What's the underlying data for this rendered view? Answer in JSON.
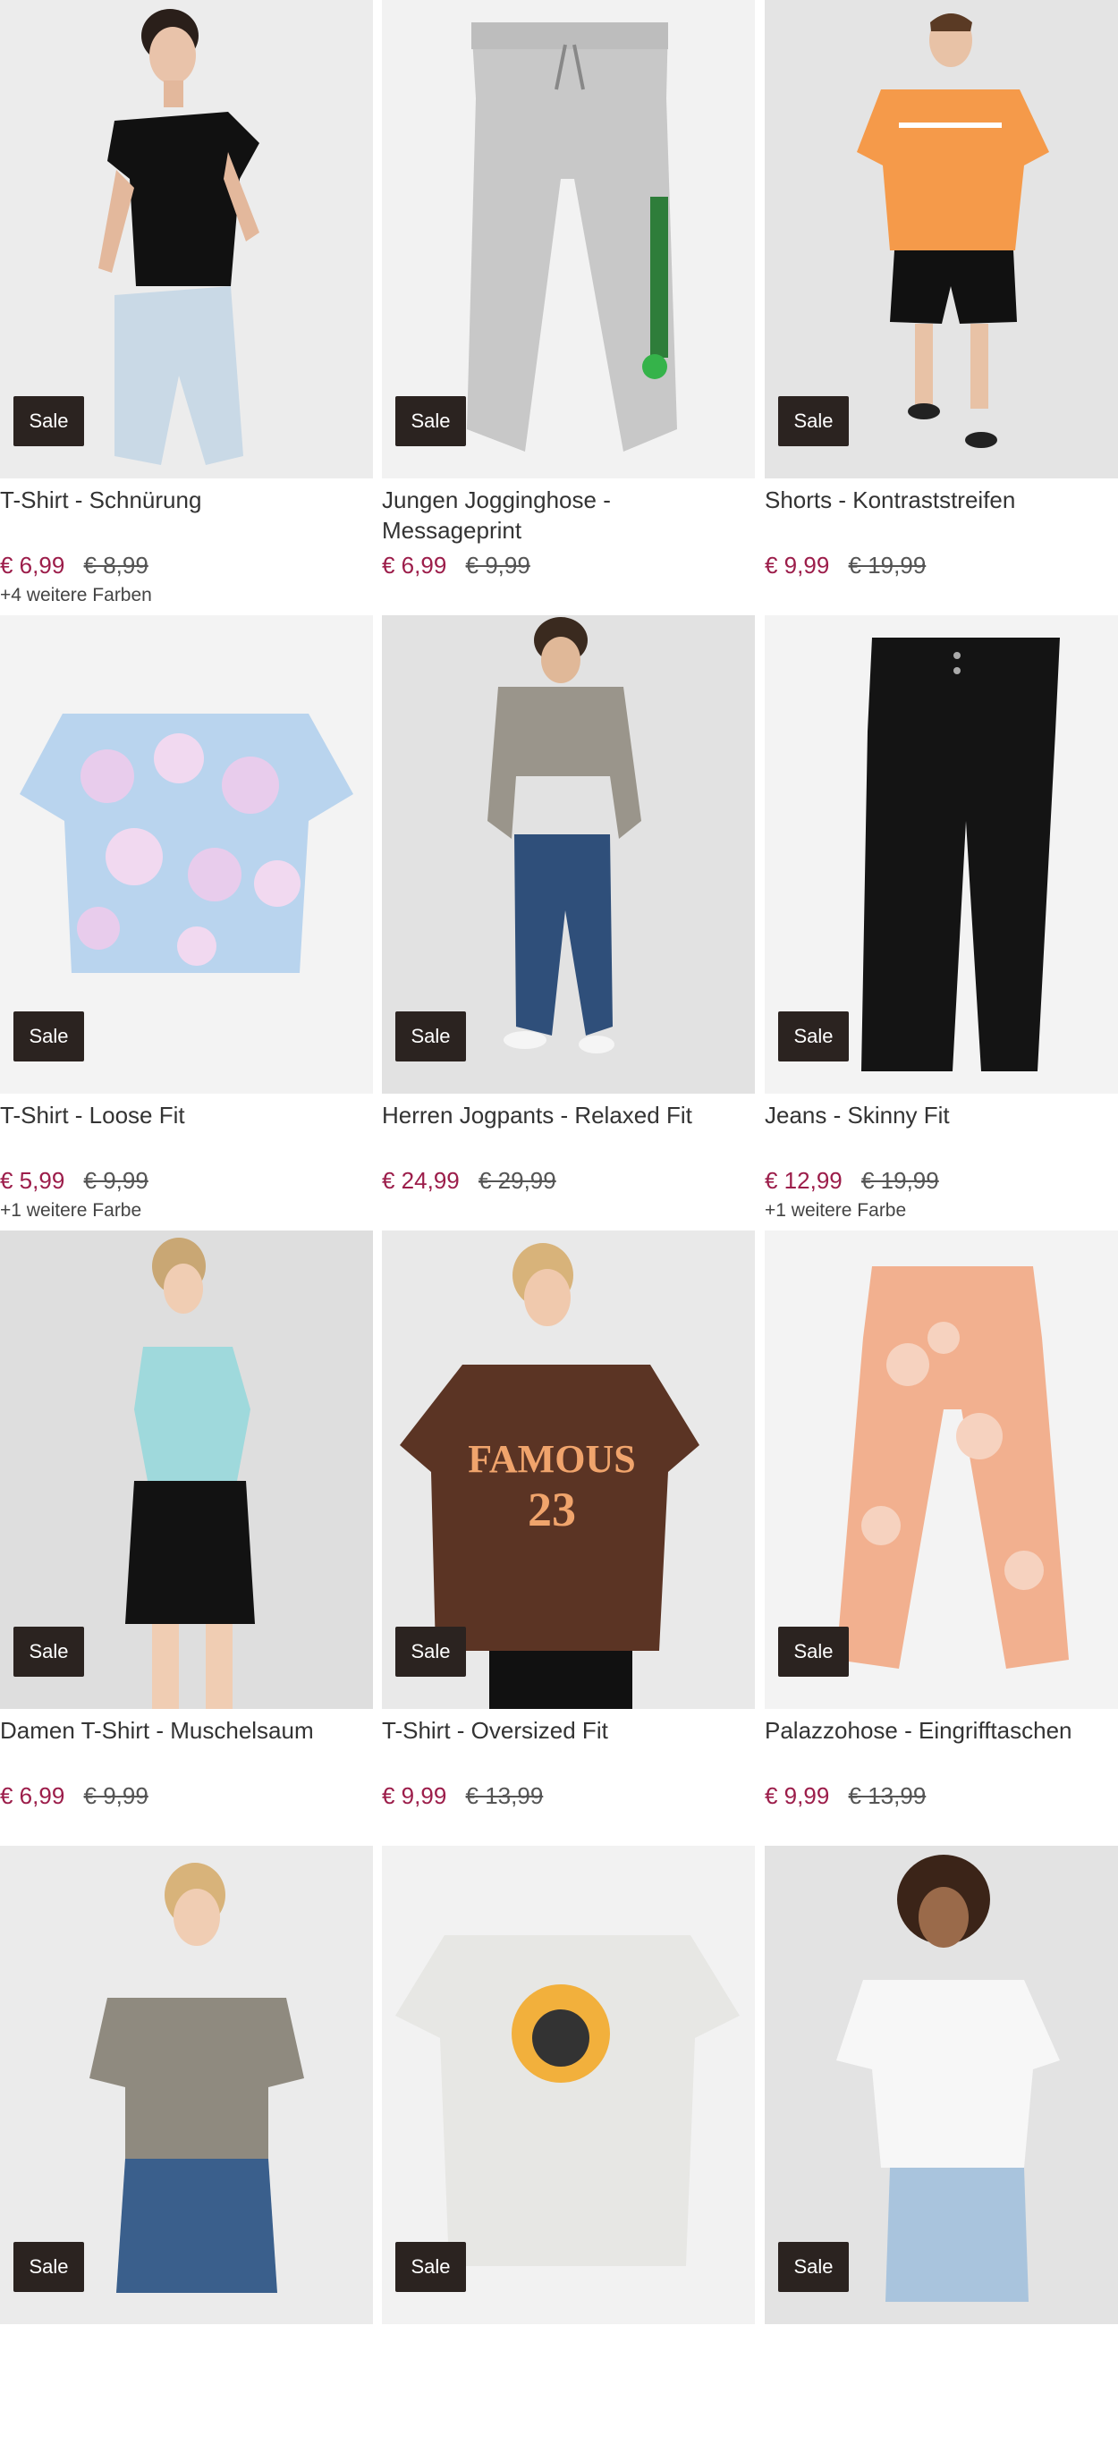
{
  "products": [
    {
      "title": "T-Shirt - Schnürung",
      "price": "€ 6,99",
      "old_price": "€ 8,99",
      "colors": "+4 weitere Farben",
      "badge": "Sale"
    },
    {
      "title": "Jungen Jogginghose - Messageprint",
      "price": "€ 6,99",
      "old_price": "€ 9,99",
      "colors": "",
      "badge": "Sale"
    },
    {
      "title": "Shorts - Kontraststreifen",
      "price": "€ 9,99",
      "old_price": "€ 19,99",
      "colors": "",
      "badge": "Sale"
    },
    {
      "title": "T-Shirt - Loose Fit",
      "price": "€ 5,99",
      "old_price": "€ 9,99",
      "colors": "+1 weitere Farbe",
      "badge": "Sale"
    },
    {
      "title": "Herren Jogpants - Relaxed Fit",
      "price": "€ 24,99",
      "old_price": "€ 29,99",
      "colors": "",
      "badge": "Sale"
    },
    {
      "title": "Jeans - Skinny Fit",
      "price": "€ 12,99",
      "old_price": "€ 19,99",
      "colors": "+1 weitere Farbe",
      "badge": "Sale"
    },
    {
      "title": "Damen T-Shirt - Muschelsaum",
      "price": "€ 6,99",
      "old_price": "€ 9,99",
      "colors": "",
      "badge": "Sale"
    },
    {
      "title": "T-Shirt - Oversized Fit",
      "price": "€ 9,99",
      "old_price": "€ 13,99",
      "colors": "",
      "badge": "Sale"
    },
    {
      "title": "Palazzohose - Eingrifftaschen",
      "price": "€ 9,99",
      "old_price": "€ 13,99",
      "colors": "",
      "badge": "Sale"
    },
    {
      "title": "",
      "price": "",
      "old_price": "",
      "colors": "",
      "badge": "Sale"
    },
    {
      "title": "",
      "price": "",
      "old_price": "",
      "colors": "",
      "badge": "Sale"
    },
    {
      "title": "",
      "price": "",
      "old_price": "",
      "colors": "",
      "badge": "Sale"
    }
  ],
  "colors": {
    "price": "#9c1d4a",
    "badge_bg": "#2b2320",
    "text": "#333333"
  }
}
